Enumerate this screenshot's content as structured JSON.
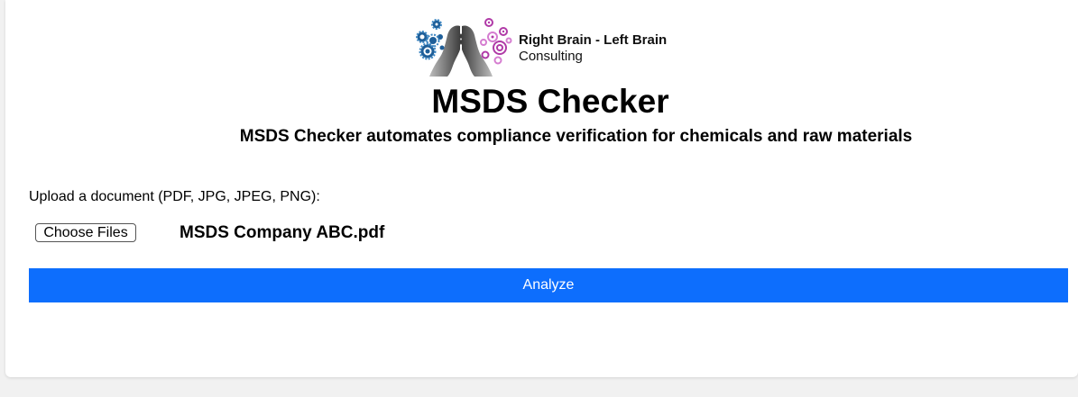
{
  "brand": {
    "line1": "Right Brain - Left Brain",
    "line2": "Consulting",
    "logo_icon": "brain-heads-gears-icon",
    "colors": {
      "gear_blue": "#1f5f99",
      "gear_light_blue": "#3c86c2",
      "swirl_purple": "#b03aa7",
      "swirl_pink": "#d57dd0",
      "head_gray": "#555555"
    }
  },
  "header": {
    "title": "MSDS Checker",
    "subtitle": "MSDS Checker automates compliance verification for chemicals and raw materials"
  },
  "upload": {
    "label": "Upload a document (PDF, JPG, JPEG, PNG):",
    "button_label": "Choose Files",
    "selected_file": "MSDS Company ABC.pdf"
  },
  "actions": {
    "analyze_label": "Analyze",
    "analyze_color": "#0d6efd"
  }
}
